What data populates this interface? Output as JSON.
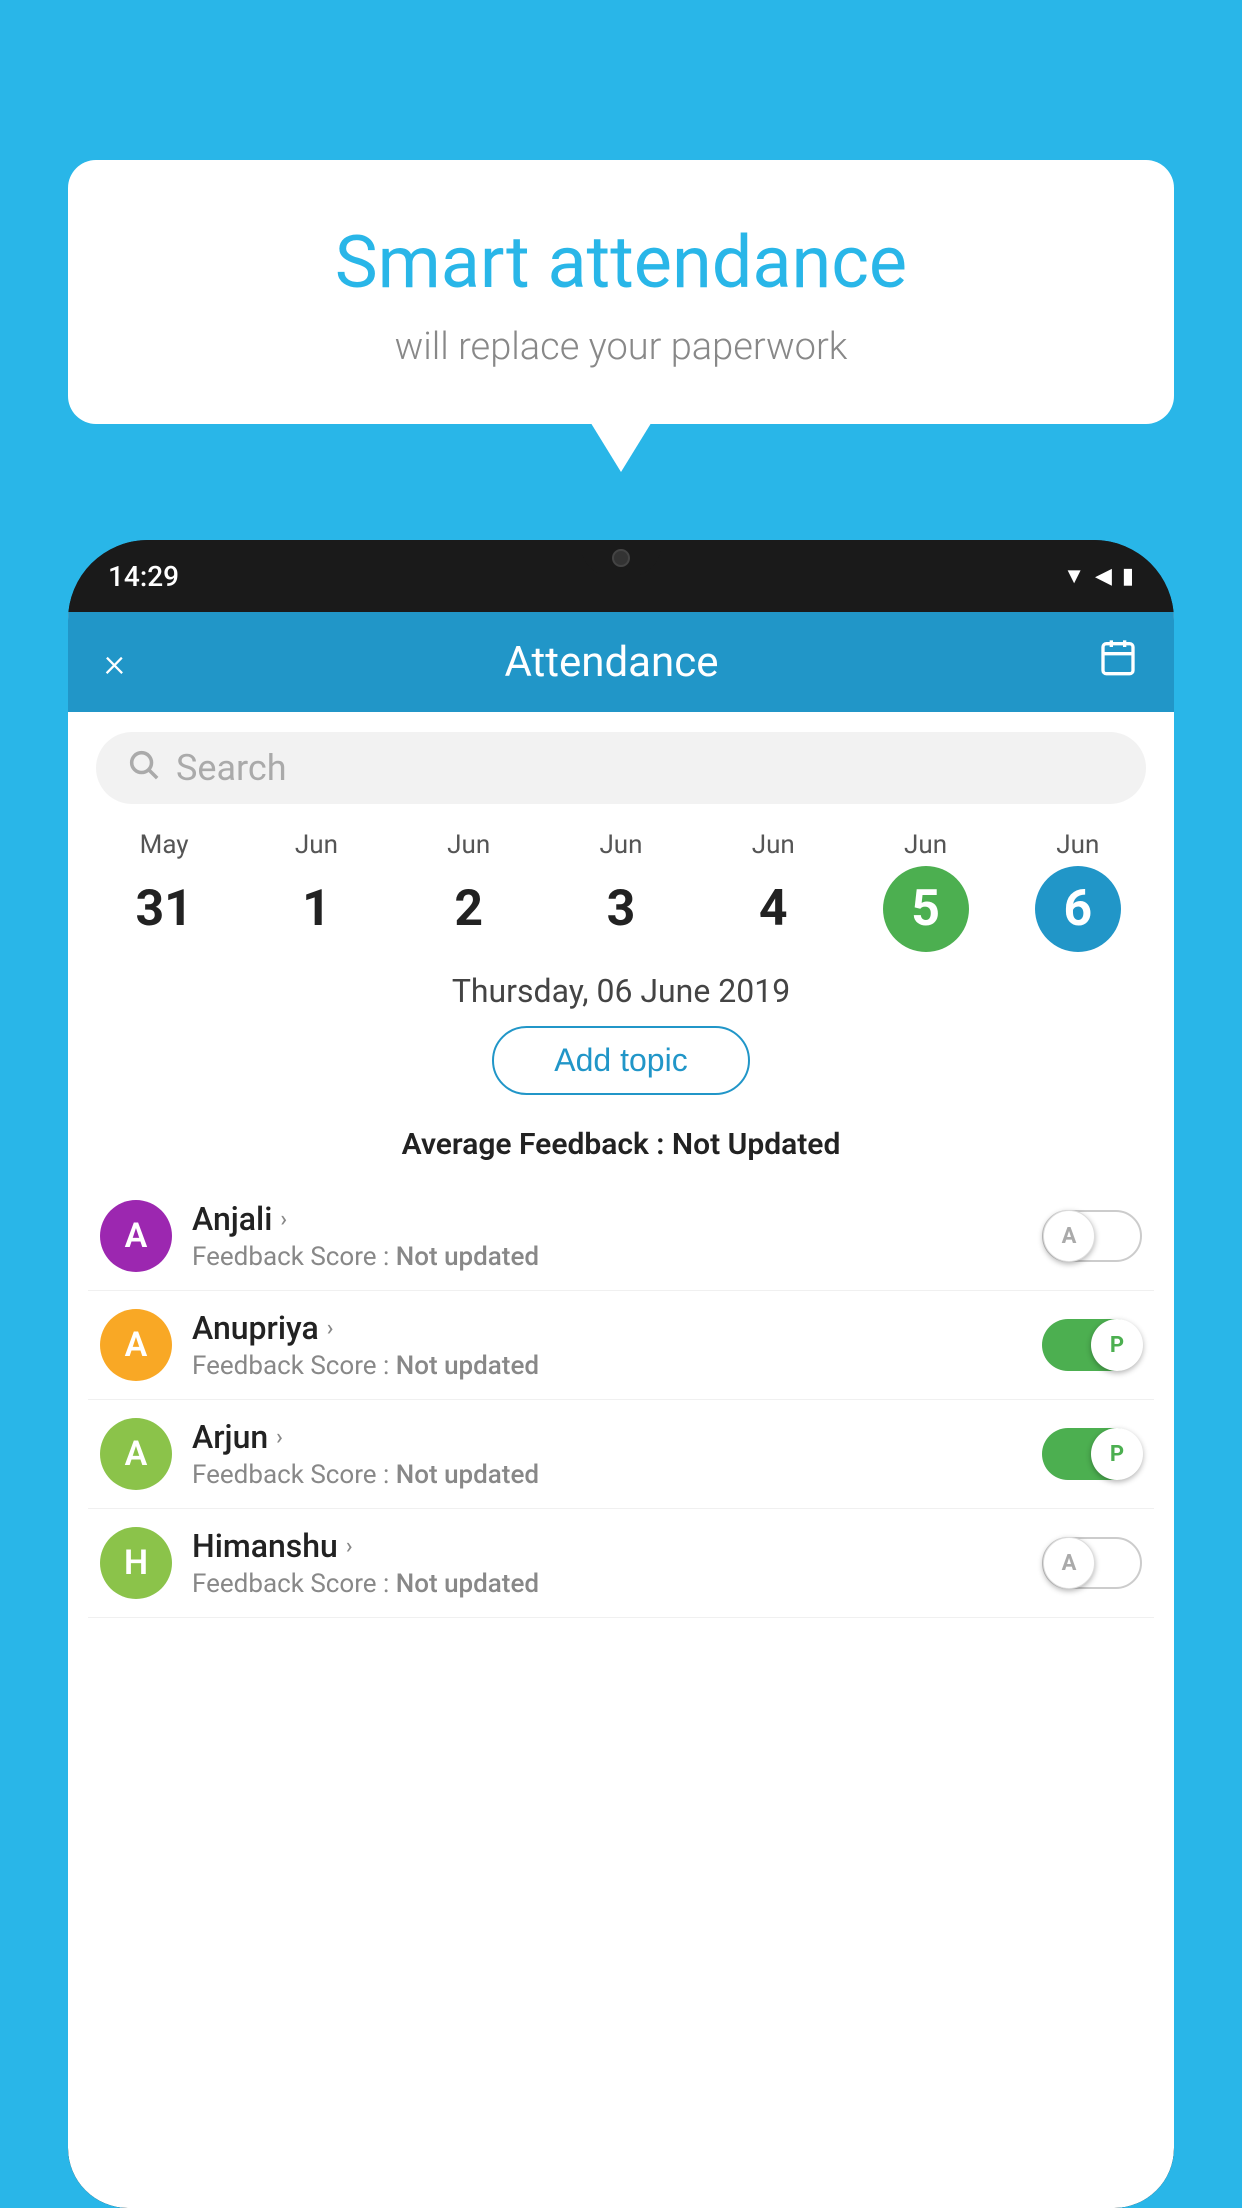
{
  "background_color": "#29b6e8",
  "speech_bubble": {
    "title": "Smart attendance",
    "subtitle": "will replace your paperwork"
  },
  "phone": {
    "time": "14:29",
    "status_icons": [
      "wifi",
      "signal",
      "battery"
    ]
  },
  "app": {
    "header": {
      "title": "Attendance",
      "close_label": "×",
      "calendar_icon": "📅"
    },
    "search": {
      "placeholder": "Search"
    },
    "calendar": {
      "days": [
        {
          "month": "May",
          "date": "31",
          "highlight": "none"
        },
        {
          "month": "Jun",
          "date": "1",
          "highlight": "none"
        },
        {
          "month": "Jun",
          "date": "2",
          "highlight": "none"
        },
        {
          "month": "Jun",
          "date": "3",
          "highlight": "none"
        },
        {
          "month": "Jun",
          "date": "4",
          "highlight": "none"
        },
        {
          "month": "Jun",
          "date": "5",
          "highlight": "green"
        },
        {
          "month": "Jun",
          "date": "6",
          "highlight": "blue"
        }
      ]
    },
    "selected_date": "Thursday, 06 June 2019",
    "add_topic_label": "Add topic",
    "avg_feedback_label": "Average Feedback :",
    "avg_feedback_value": "Not Updated",
    "students": [
      {
        "name": "Anjali",
        "avatar_letter": "A",
        "avatar_color": "#9c27b0",
        "feedback_label": "Feedback Score :",
        "feedback_value": "Not updated",
        "toggle": "off",
        "toggle_letter": "A"
      },
      {
        "name": "Anupriya",
        "avatar_letter": "A",
        "avatar_color": "#f9a825",
        "feedback_label": "Feedback Score :",
        "feedback_value": "Not updated",
        "toggle": "on",
        "toggle_letter": "P"
      },
      {
        "name": "Arjun",
        "avatar_letter": "A",
        "avatar_color": "#8bc34a",
        "feedback_label": "Feedback Score :",
        "feedback_value": "Not updated",
        "toggle": "on",
        "toggle_letter": "P"
      },
      {
        "name": "Himanshu",
        "avatar_letter": "H",
        "avatar_color": "#8bc34a",
        "feedback_label": "Feedback Score :",
        "feedback_value": "Not updated",
        "toggle": "off",
        "toggle_letter": "A"
      }
    ]
  }
}
